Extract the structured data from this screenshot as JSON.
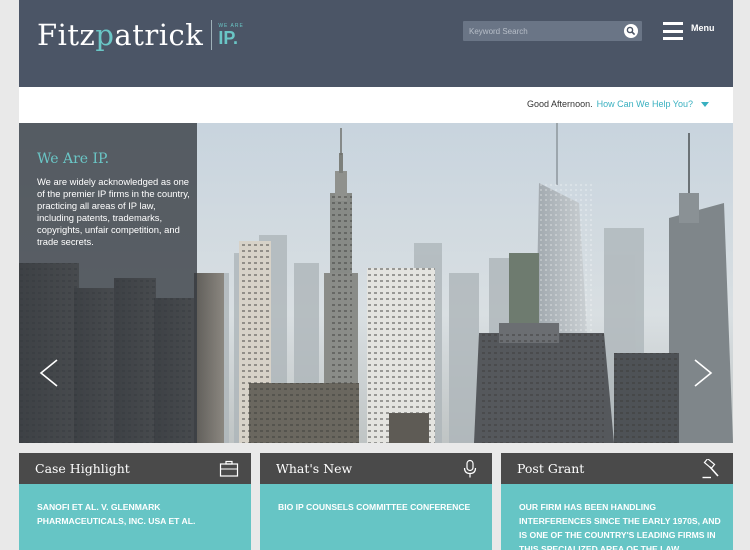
{
  "header": {
    "logo": {
      "pre": "Fitz",
      "accent": "p",
      "post": "atrick",
      "badge_small": "WE ARE",
      "badge_big": "IP."
    },
    "search": {
      "placeholder": "Keyword Search"
    },
    "menu_label": "Menu"
  },
  "greeting": {
    "text": "Good Afternoon.",
    "help": "How Can We Help You?"
  },
  "hero": {
    "title": "We Are IP.",
    "text": "We are widely acknowledged as one of the premier IP firms in the country, practicing all areas of IP law, including patents, trademarks, copyrights, unfair competition, and trade secrets."
  },
  "cards": [
    {
      "title": "Case Highlight",
      "icon": "briefcase-icon",
      "text": "SANOFI ET AL. V. GLENMARK PHARMACEUTICALS, INC. USA ET AL."
    },
    {
      "title": "What's New",
      "icon": "microphone-icon",
      "text": "BIO IP COUNSELS COMMITTEE CONFERENCE"
    },
    {
      "title": "Post Grant",
      "icon": "gavel-icon",
      "text": "OUR FIRM HAS BEEN HANDLING INTERFERENCES SINCE THE EARLY 1970S, AND IS ONE OF THE COUNTRY'S LEADING FIRMS IN THIS SPECIALIZED AREA OF THE LAW"
    }
  ],
  "colors": {
    "header_bg": "#4b5566",
    "accent": "#6ac6c6",
    "card_head": "#4a4a4a",
    "card_body": "#66c5c5",
    "link": "#39b0c0"
  }
}
